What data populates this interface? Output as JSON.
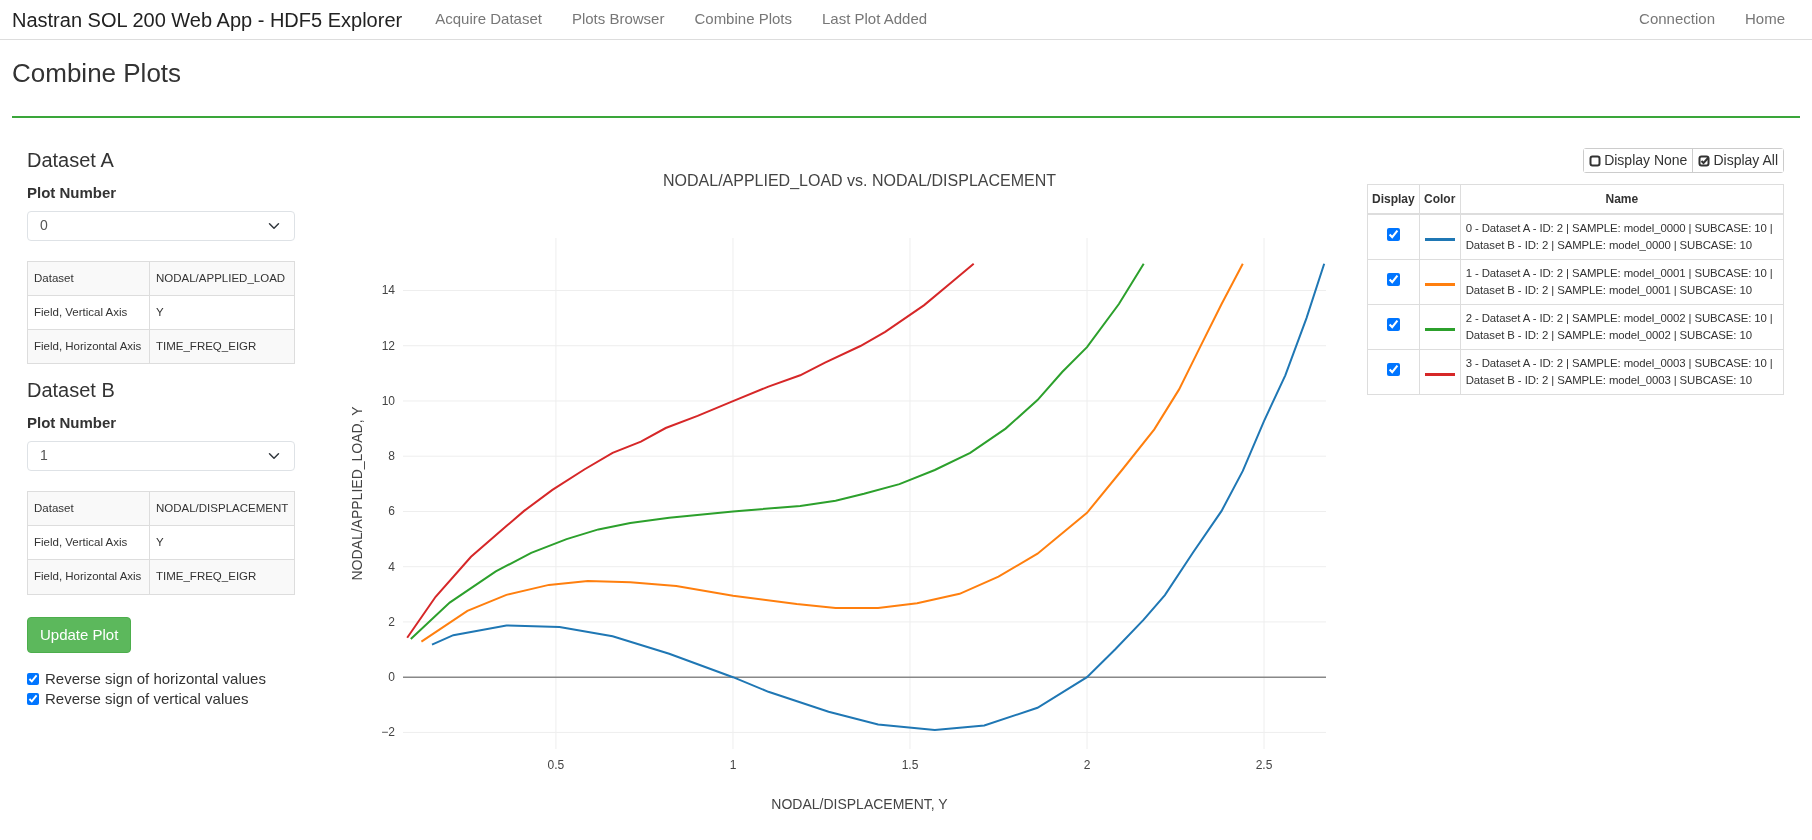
{
  "navbar": {
    "brand": "Nastran SOL 200 Web App - HDF5 Explorer",
    "links": [
      "Acquire Dataset",
      "Plots Browser",
      "Combine Plots",
      "Last Plot Added"
    ],
    "right_links": [
      "Connection",
      "Home"
    ]
  },
  "page_title": "Combine Plots",
  "datasets": [
    {
      "heading": "Dataset A",
      "plot_number_label": "Plot Number",
      "plot_number": "0",
      "table": [
        {
          "label": "Dataset",
          "value": "NODAL/APPLIED_LOAD"
        },
        {
          "label": "Field, Vertical Axis",
          "value": "Y"
        },
        {
          "label": "Field, Horizontal Axis",
          "value": "TIME_FREQ_EIGR"
        }
      ]
    },
    {
      "heading": "Dataset B",
      "plot_number_label": "Plot Number",
      "plot_number": "1",
      "table": [
        {
          "label": "Dataset",
          "value": "NODAL/DISPLACEMENT"
        },
        {
          "label": "Field, Vertical Axis",
          "value": "Y"
        },
        {
          "label": "Field, Horizontal Axis",
          "value": "TIME_FREQ_EIGR"
        }
      ]
    }
  ],
  "update_button": "Update Plot",
  "options": [
    {
      "label": "Reverse sign of horizontal values",
      "checked": true
    },
    {
      "label": "Reverse sign of vertical values",
      "checked": true
    }
  ],
  "chart": {
    "chart_data": {
      "type": "line",
      "grid": true,
      "title": "NODAL/APPLIED_LOAD vs. NODAL/DISPLACEMENT",
      "xlabel": "NODAL/DISPLACEMENT, Y",
      "ylabel": "NODAL/APPLIED_LOAD, Y",
      "xlim": [
        0.068,
        2.675
      ],
      "ylim": [
        -2.6,
        15.9
      ],
      "xticks": [
        0.5,
        1,
        1.5,
        2,
        2.5
      ],
      "yticks": [
        {
          "value": -2,
          "label": "−2"
        },
        0,
        2,
        4,
        6,
        8,
        10,
        12,
        14
      ],
      "series": [
        {
          "color": "#1f77b4",
          "x": [
            0.15,
            0.21,
            0.36,
            0.51,
            0.66,
            0.82,
            1.0,
            1.1,
            1.27,
            1.41,
            1.57,
            1.71,
            1.86,
            2.0,
            2.08,
            2.16,
            2.22,
            2.3,
            2.38,
            2.44,
            2.5,
            2.56,
            2.62,
            2.67
          ],
          "values": [
            1.18,
            1.52,
            1.87,
            1.82,
            1.48,
            0.85,
            0,
            -0.53,
            -1.25,
            -1.71,
            -1.91,
            -1.75,
            -1.11,
            0,
            1.01,
            2.08,
            2.97,
            4.52,
            6.02,
            7.47,
            9.27,
            10.93,
            13.0,
            14.97
          ]
        },
        {
          "color": "#ff7f0e",
          "x": [
            0.12,
            0.25,
            0.36,
            0.48,
            0.59,
            0.71,
            0.84,
            1.0,
            1.18,
            1.29,
            1.41,
            1.52,
            1.64,
            1.75,
            1.86,
            2.0,
            2.1,
            2.19,
            2.26,
            2.32,
            2.38,
            2.44
          ],
          "values": [
            1.29,
            2.4,
            2.98,
            3.34,
            3.48,
            3.44,
            3.3,
            2.95,
            2.65,
            2.51,
            2.51,
            2.68,
            3.02,
            3.64,
            4.47,
            5.95,
            7.52,
            8.97,
            10.42,
            11.97,
            13.51,
            14.97
          ]
        },
        {
          "color": "#2ca02c",
          "x": [
            0.09,
            0.2,
            0.33,
            0.43,
            0.53,
            0.62,
            0.71,
            0.82,
            1.0,
            1.19,
            1.29,
            1.37,
            1.47,
            1.57,
            1.67,
            1.77,
            1.86,
            1.93,
            2.0,
            2.09,
            2.16
          ],
          "values": [
            1.38,
            2.7,
            3.83,
            4.5,
            5.0,
            5.35,
            5.58,
            5.77,
            6.0,
            6.2,
            6.39,
            6.64,
            6.99,
            7.5,
            8.12,
            9.0,
            10.03,
            11.05,
            11.95,
            13.51,
            14.97
          ]
        },
        {
          "color": "#d62728",
          "x": [
            0.08,
            0.16,
            0.26,
            0.36,
            0.41,
            0.49,
            0.58,
            0.66,
            0.74,
            0.81,
            0.9,
            1.0,
            1.1,
            1.19,
            1.26,
            1.36,
            1.43,
            1.54,
            1.62,
            1.68
          ],
          "values": [
            1.43,
            2.91,
            4.36,
            5.47,
            6.02,
            6.78,
            7.52,
            8.12,
            8.53,
            9.02,
            9.46,
            9.99,
            10.52,
            10.93,
            11.39,
            11.99,
            12.5,
            13.47,
            14.32,
            14.97
          ]
        }
      ]
    }
  },
  "legend": {
    "buttons": [
      {
        "label": "Display None",
        "kind": "none"
      },
      {
        "label": "Display All",
        "kind": "all"
      }
    ],
    "columns": [
      "Display",
      "Color",
      "Name"
    ],
    "rows": [
      {
        "checked": true,
        "color": "#1f77b4",
        "name": "0 - Dataset A - ID: 2 | SAMPLE: model_0000 | SUBCASE: 10 | Dataset B - ID: 2 | SAMPLE: model_0000 | SUBCASE: 10"
      },
      {
        "checked": true,
        "color": "#ff7f0e",
        "name": "1 - Dataset A - ID: 2 | SAMPLE: model_0001 | SUBCASE: 10 | Dataset B - ID: 2 | SAMPLE: model_0001 | SUBCASE: 10"
      },
      {
        "checked": true,
        "color": "#2ca02c",
        "name": "2 - Dataset A - ID: 2 | SAMPLE: model_0002 | SUBCASE: 10 | Dataset B - ID: 2 | SAMPLE: model_0002 | SUBCASE: 10"
      },
      {
        "checked": true,
        "color": "#d62728",
        "name": "3 - Dataset A - ID: 2 | SAMPLE: model_0003 | SUBCASE: 10 | Dataset B - ID: 2 | SAMPLE: model_0003 | SUBCASE: 10"
      }
    ]
  }
}
